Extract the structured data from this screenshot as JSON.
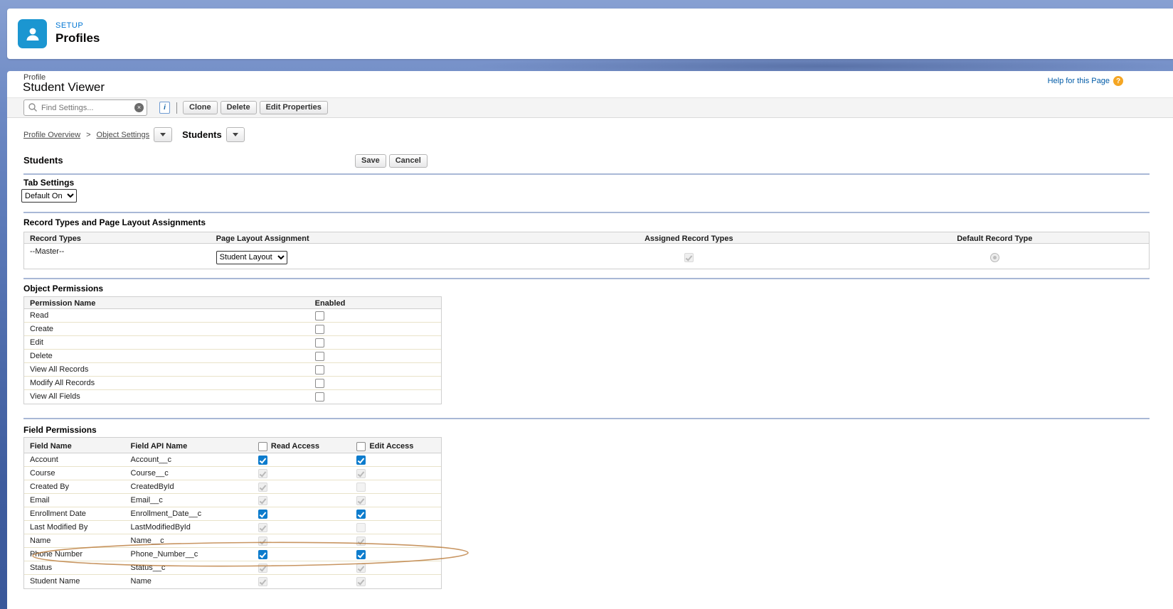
{
  "header": {
    "eyebrow": "SETUP",
    "title": "Profiles"
  },
  "page": {
    "entity_label": "Profile",
    "entity_name": "Student Viewer",
    "help_link": "Help for this Page"
  },
  "icons": {
    "info": "i",
    "help": "?",
    "clear": "×"
  },
  "toolbar": {
    "search_placeholder": "Find Settings...",
    "clone_label": "Clone",
    "delete_label": "Delete",
    "edit_properties_label": "Edit Properties"
  },
  "breadcrumb": {
    "items": [
      "Profile Overview",
      "Object Settings"
    ],
    "separator": ">",
    "current": "Students"
  },
  "section": {
    "title": "Students",
    "save_label": "Save",
    "cancel_label": "Cancel"
  },
  "tab_settings": {
    "label": "Tab Settings",
    "value": "Default On"
  },
  "record_types": {
    "title": "Record Types and Page Layout Assignments",
    "columns": [
      "Record Types",
      "Page Layout Assignment",
      "Assigned Record Types",
      "Default Record Type"
    ],
    "rows": [
      {
        "record_type": "--Master--",
        "page_layout": "Student Layout",
        "assigned": "cb-dis-on",
        "default_state": "radio-dis"
      }
    ]
  },
  "object_permissions": {
    "title": "Object Permissions",
    "columns": [
      "Permission Name",
      "Enabled"
    ],
    "rows": [
      {
        "name": "Read",
        "enabled": "cb-off"
      },
      {
        "name": "Create",
        "enabled": "cb-off"
      },
      {
        "name": "Edit",
        "enabled": "cb-off"
      },
      {
        "name": "Delete",
        "enabled": "cb-off"
      },
      {
        "name": "View All Records",
        "enabled": "cb-off"
      },
      {
        "name": "Modify All Records",
        "enabled": "cb-off"
      },
      {
        "name": "View All Fields",
        "enabled": "cb-off"
      }
    ]
  },
  "field_permissions": {
    "title": "Field Permissions",
    "columns": [
      "Field Name",
      "Field API Name",
      "Read Access",
      "Edit Access"
    ],
    "header_checkboxes": {
      "read": "cb-off",
      "edit": "cb-off"
    },
    "rows": [
      {
        "field": "Account",
        "api": "Account__c",
        "read": "cb-on",
        "edit": "cb-on"
      },
      {
        "field": "Course",
        "api": "Course__c",
        "read": "cb-dis-on",
        "edit": "cb-dis-on"
      },
      {
        "field": "Created By",
        "api": "CreatedById",
        "read": "cb-dis-on",
        "edit": "cb-dis-off"
      },
      {
        "field": "Email",
        "api": "Email__c",
        "read": "cb-dis-on",
        "edit": "cb-dis-on"
      },
      {
        "field": "Enrollment Date",
        "api": "Enrollment_Date__c",
        "read": "cb-on",
        "edit": "cb-on"
      },
      {
        "field": "Last Modified By",
        "api": "LastModifiedById",
        "read": "cb-dis-on",
        "edit": "cb-dis-off"
      },
      {
        "field": "Name",
        "api": "Name__c",
        "read": "cb-dis-on",
        "edit": "cb-dis-on"
      },
      {
        "field": "Phone Number",
        "api": "Phone_Number__c",
        "read": "cb-on",
        "edit": "cb-on"
      },
      {
        "field": "Status",
        "api": "Status__c",
        "read": "cb-dis-on",
        "edit": "cb-dis-on"
      },
      {
        "field": "Student Name",
        "api": "Name",
        "read": "cb-dis-on",
        "edit": "cb-dis-on"
      }
    ]
  },
  "annotation": {
    "color": "#b5712c"
  },
  "colors": {
    "checkbox_checked": "#0d7ccd",
    "setup_icon": "#1b96d1",
    "eyebrow_link": "#0176d3",
    "help_link": "#015ba7",
    "section_rule": "#a9b8d6",
    "row_border": "#e9e3c9"
  }
}
